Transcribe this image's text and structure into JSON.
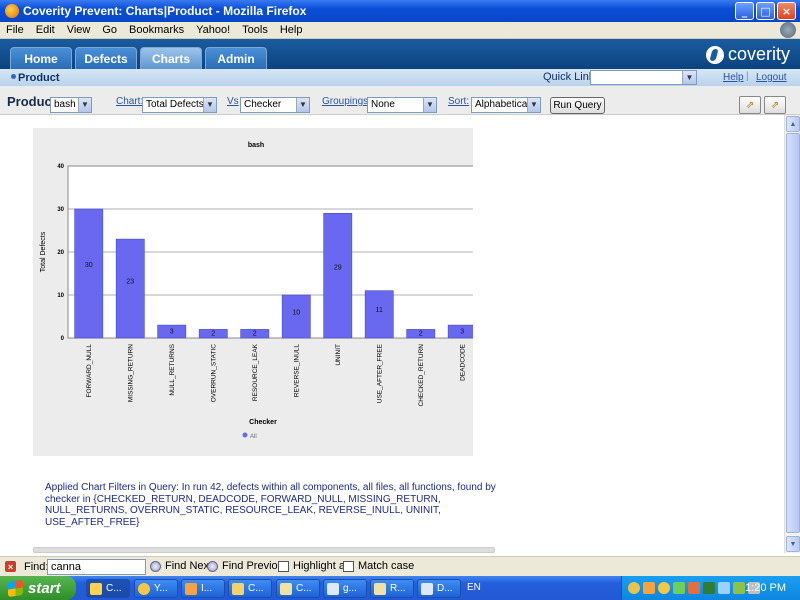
{
  "window": {
    "title": "Coverity Prevent: Charts|Product - Mozilla Firefox",
    "min": "_",
    "max": "□",
    "close": "×"
  },
  "menu": [
    "File",
    "Edit",
    "View",
    "Go",
    "Bookmarks",
    "Yahoo!",
    "Tools",
    "Help"
  ],
  "tabs": [
    "Home",
    "Defects",
    "Charts",
    "Admin"
  ],
  "logo_text": "coverity",
  "subbar": {
    "crumb": "Product",
    "quick_links_label": "Quick Links:",
    "quick_links_value": "",
    "help": "Help",
    "logout": "Logout"
  },
  "controls": {
    "product_label": "Product",
    "product_value": "bash",
    "chart_label": "Chart:",
    "chart_value": "Total Defects",
    "vs_label": "Vs",
    "vs_value": "Checker",
    "groupings_label": "Groupings:",
    "groupings_value": "None",
    "sort_label": "Sort:",
    "sort_value": "Alphabetical",
    "run_query": "Run Query"
  },
  "chart_data": {
    "type": "bar",
    "title": "bash",
    "xlabel": "Checker",
    "ylabel": "Total Defects",
    "ylim": [
      0,
      40
    ],
    "yticks": [
      0,
      10,
      20,
      30,
      40
    ],
    "grid": true,
    "legend_position": "bottom",
    "bar_color": "#6868f0",
    "categories": [
      "FORWARD_NULL",
      "MISSING_RETURN",
      "NULL_RETURNS",
      "OVERRUN_STATIC",
      "RESOURCE_LEAK",
      "REVERSE_INULL",
      "UNINIT",
      "USE_AFTER_FREE",
      "CHECKED_RETURN",
      "DEADCODE"
    ],
    "series": [
      {
        "name": "All",
        "values": [
          30,
          23,
          3,
          2,
          2,
          10,
          29,
          11,
          2,
          3
        ]
      }
    ]
  },
  "filters_text": "Applied Chart Filters in Query: In run 42, defects within all components, all files, all functions, found by checker in {CHECKED_RETURN, DEADCODE, FORWARD_NULL, MISSING_RETURN, NULL_RETURNS, OVERRUN_STATIC, RESOURCE_LEAK, REVERSE_INULL, UNINIT, USE_AFTER_FREE}",
  "findbar": {
    "label": "Find:",
    "value": "canna",
    "next": "Find Next",
    "previous": "Find Previous",
    "highlight": "Highlight all",
    "match_case": "Match case"
  },
  "taskbar": {
    "start": "start",
    "items": [
      "C...",
      "Y...",
      "I...",
      "C...",
      "C...",
      "g...",
      "R...",
      "D..."
    ],
    "lang": "EN",
    "clock": "1:20 PM"
  }
}
